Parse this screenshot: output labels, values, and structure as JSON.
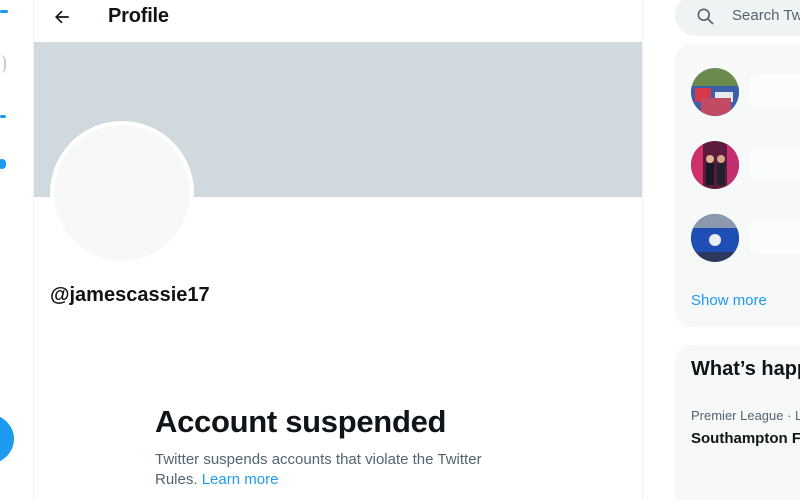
{
  "header": {
    "title": "Profile"
  },
  "profile": {
    "handle": "@jamescassie17",
    "suspended_title": "Account suspended",
    "suspended_body": "Twitter suspends accounts that violate the Twitter Rules.",
    "learn_more": "Learn more"
  },
  "sidebar": {
    "search_placeholder": "Search Twitter",
    "who_to_follow": [
      {
        "avatar": "crowd-photo-avatar"
      },
      {
        "avatar": "two-people-photo-avatar"
      },
      {
        "avatar": "club-badge-avatar"
      }
    ],
    "show_more": "Show more",
    "trends_title": "What’s happening",
    "trend_meta": "Premier League · LIVE",
    "trend_name": "Southampton FC"
  },
  "colors": {
    "accent": "#1d9bf0",
    "banner": "#cfd9de",
    "muted_text": "#536471"
  }
}
